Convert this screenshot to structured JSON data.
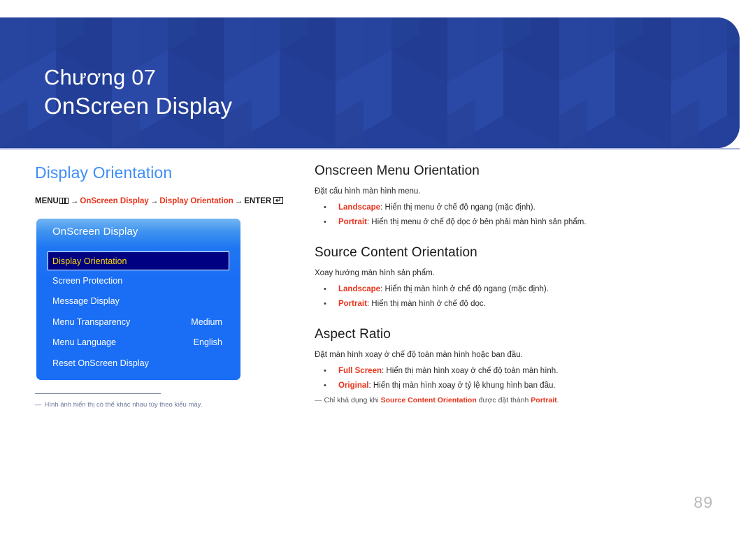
{
  "banner": {
    "chapter_number": "Chương 07",
    "chapter_title": "OnScreen Display",
    "background_color": "#24409a"
  },
  "left": {
    "section_heading": "Display Orientation",
    "section_heading_color": "#3f8ef7",
    "menu_path": {
      "menu_label": "MENU",
      "menu_icon": "menu-bars-icon",
      "arrow1": "→",
      "step1": "OnScreen Display",
      "arrow2": "→",
      "step2": "Display Orientation",
      "arrow3": "→",
      "enter_label": "ENTER",
      "enter_icon": "enter-key-icon",
      "enter_glyph": "↵",
      "highlight_color": "#e8331c"
    },
    "osd": {
      "title": "OnScreen Display",
      "selected_index": 0,
      "selected_bg": "#000082",
      "selected_text_color": "#ffd900",
      "panel_color": "#1a6ef5",
      "rows": [
        {
          "label": "Display Orientation",
          "value": ""
        },
        {
          "label": "Screen Protection",
          "value": ""
        },
        {
          "label": "Message Display",
          "value": ""
        },
        {
          "label": "Menu Transparency",
          "value": "Medium"
        },
        {
          "label": "Menu Language",
          "value": "English"
        },
        {
          "label": "Reset OnScreen Display",
          "value": ""
        }
      ]
    },
    "footnote": {
      "dash": "―",
      "text": "Hình ảnh hiển thị có thể khác nhau tùy theo kiểu máy."
    }
  },
  "right": {
    "blocks": [
      {
        "heading": "Onscreen Menu Orientation",
        "intro": "Đặt cấu hình màn hình menu.",
        "bullets": [
          {
            "term": "Landscape",
            "text": ": Hiển thị menu ở chế độ ngang (mặc định)."
          },
          {
            "term": "Portrait",
            "text": ": Hiển thị menu ở chế độ dọc ở bên phải màn hình sản phẩm."
          }
        ]
      },
      {
        "heading": "Source Content Orientation",
        "intro": "Xoay hướng màn hình sản phẩm.",
        "bullets": [
          {
            "term": "Landscape",
            "text": ": Hiển thị màn hình ở chế độ ngang (mặc định)."
          },
          {
            "term": "Portrait",
            "text": ": Hiển thị màn hình ở chế độ dọc."
          }
        ]
      },
      {
        "heading": "Aspect Ratio",
        "intro": "Đặt màn hình xoay ở chế độ toàn màn hình hoặc ban đầu.",
        "bullets": [
          {
            "term": "Full Screen",
            "text": ": Hiển thị màn hình xoay ở chế độ toàn màn hình."
          },
          {
            "term": "Original",
            "text": ": Hiển thị màn hình xoay ở tỷ lệ khung hình ban đầu."
          }
        ],
        "footnote": {
          "dash": "―",
          "pre": "Chỉ khả dụng khi ",
          "bold1": "Source Content Orientation",
          "mid": " được đặt thành ",
          "bold2": "Portrait",
          "post": "."
        }
      }
    ]
  },
  "page_number": "89"
}
